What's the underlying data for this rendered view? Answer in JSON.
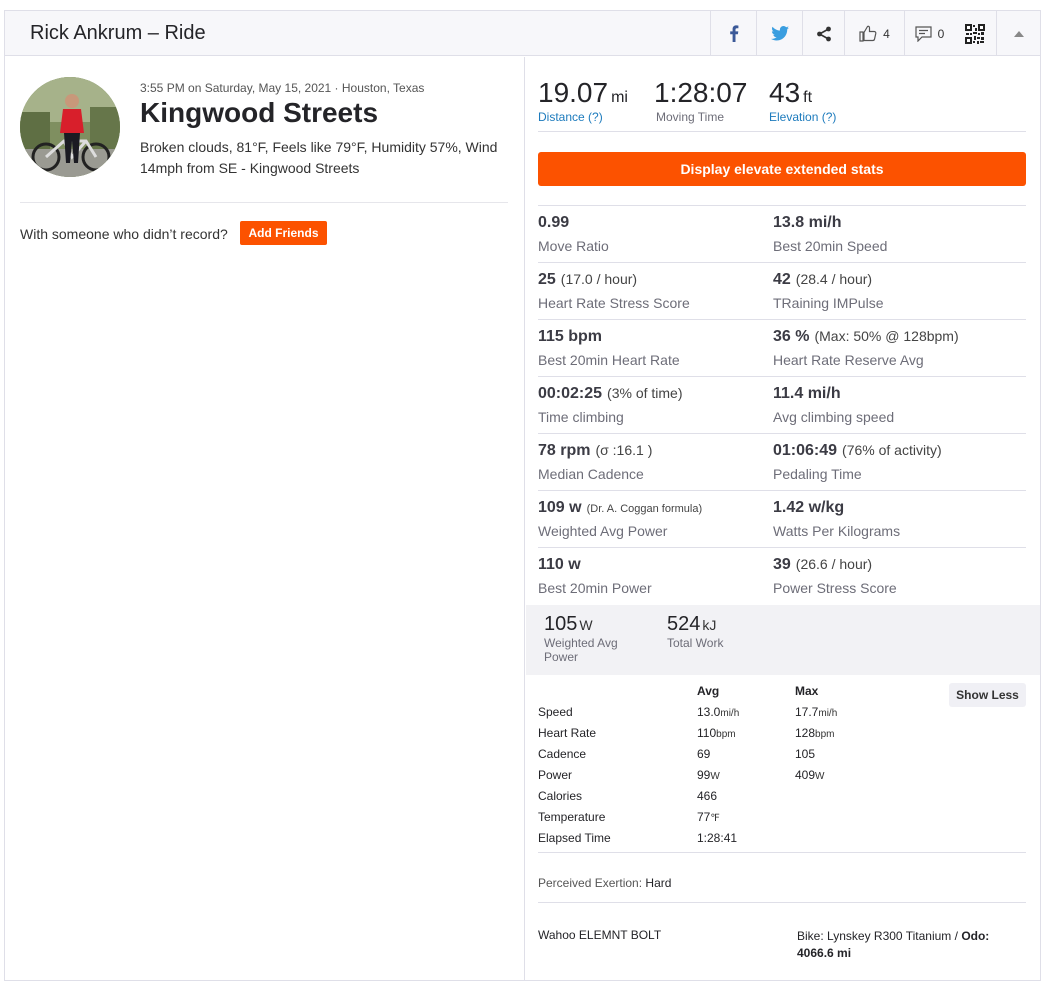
{
  "header": {
    "title": "Rick Ankrum – Ride",
    "kudos_count": "4",
    "comments_count": "0",
    "icons": [
      "facebook-icon",
      "twitter-icon",
      "share-icon",
      "thumbs-up-icon",
      "comment-icon",
      "qr-code-icon",
      "collapse-arrow-icon"
    ]
  },
  "activity": {
    "meta": "3:55 PM on Saturday, May 15, 2021 · Houston, Texas",
    "title": "Kingwood Streets",
    "weather": "Broken clouds, 81°F, Feels like 79°F, Humidity 57%, Wind 14mph from SE - Kingwood Streets",
    "friends_prompt": "With someone who didn’t record?",
    "add_friends_label": "Add Friends"
  },
  "top_stats": {
    "distance": {
      "value": "19.07",
      "unit": "mi",
      "label": "Distance",
      "help": "(?)"
    },
    "moving_time": {
      "value": "1:28:07",
      "label": "Moving Time"
    },
    "elevation": {
      "value": "43",
      "unit": "ft",
      "label": "Elevation",
      "help": "(?)"
    }
  },
  "elevate_button": "Display elevate extended stats",
  "extended_stats": [
    {
      "value": "0.99",
      "sub": "",
      "label": "Move Ratio"
    },
    {
      "value": "13.8 mi/h",
      "sub": "",
      "label": "Best 20min Speed"
    },
    {
      "value": "25",
      "sub": "(17.0 / hour)",
      "label": "Heart Rate Stress Score"
    },
    {
      "value": "42",
      "sub": "(28.4 / hour)",
      "label": "TRaining IMPulse"
    },
    {
      "value": "115 bpm",
      "sub": "",
      "label": "Best 20min Heart Rate"
    },
    {
      "value": "36 %",
      "sub": "(Max: 50% @ 128bpm)",
      "label": "Heart Rate Reserve Avg"
    },
    {
      "value": "00:02:25",
      "sub": "(3% of time)",
      "label": "Time climbing"
    },
    {
      "value": "11.4 mi/h",
      "sub": "",
      "label": "Avg climbing speed"
    },
    {
      "value": "78 rpm",
      "sub": "(σ :16.1 )",
      "label": "Median Cadence"
    },
    {
      "value": "01:06:49",
      "sub": "(76% of activity)",
      "label": "Pedaling Time"
    },
    {
      "value": "109 w",
      "sub": "(Dr. A. Coggan formula)",
      "label": "Weighted Avg Power"
    },
    {
      "value": "1.42 w/kg",
      "sub": "",
      "label": "Watts Per Kilograms"
    },
    {
      "value": "110 w",
      "sub": "",
      "label": "Best 20min Power"
    },
    {
      "value": "39",
      "sub": "(26.6 / hour)",
      "label": "Power Stress Score"
    }
  ],
  "power_band": {
    "weighted_avg": {
      "value": "105",
      "unit": "W",
      "label_line1": "Weighted Avg",
      "label_line2": "Power"
    },
    "total_work": {
      "value": "524",
      "unit": "kJ",
      "label": "Total Work"
    }
  },
  "mini_table": {
    "col_avg": "Avg",
    "col_max": "Max",
    "show_less_label": "Show Less",
    "rows": [
      {
        "label": "Speed",
        "avg": "13.0",
        "avg_unit": "mi/h",
        "max": "17.7",
        "max_unit": "mi/h"
      },
      {
        "label": "Heart Rate",
        "avg": "110",
        "avg_unit": "bpm",
        "max": "128",
        "max_unit": "bpm"
      },
      {
        "label": "Cadence",
        "avg": "69",
        "avg_unit": "",
        "max": "105",
        "max_unit": ""
      },
      {
        "label": "Power",
        "avg": "99",
        "avg_unit": "W",
        "max": "409",
        "max_unit": "W"
      },
      {
        "label": "Calories",
        "avg": "466",
        "avg_unit": "",
        "max": "",
        "max_unit": ""
      },
      {
        "label": "Temperature",
        "avg": "77",
        "avg_unit": "℉",
        "max": "",
        "max_unit": ""
      },
      {
        "label": "Elapsed Time",
        "avg": "1:28:41",
        "avg_unit": "",
        "max": "",
        "max_unit": ""
      }
    ]
  },
  "footer": {
    "exertion_label": "Perceived Exertion:",
    "exertion_value": "Hard",
    "device": "Wahoo ELEMNT BOLT",
    "bike_prefix": "Bike: Lynskey R300 Titanium /",
    "odo_label": "Odo:",
    "odo_value": "4066.6 mi"
  },
  "colors": {
    "accent": "#fc5200",
    "link": "#1d7bbd"
  }
}
